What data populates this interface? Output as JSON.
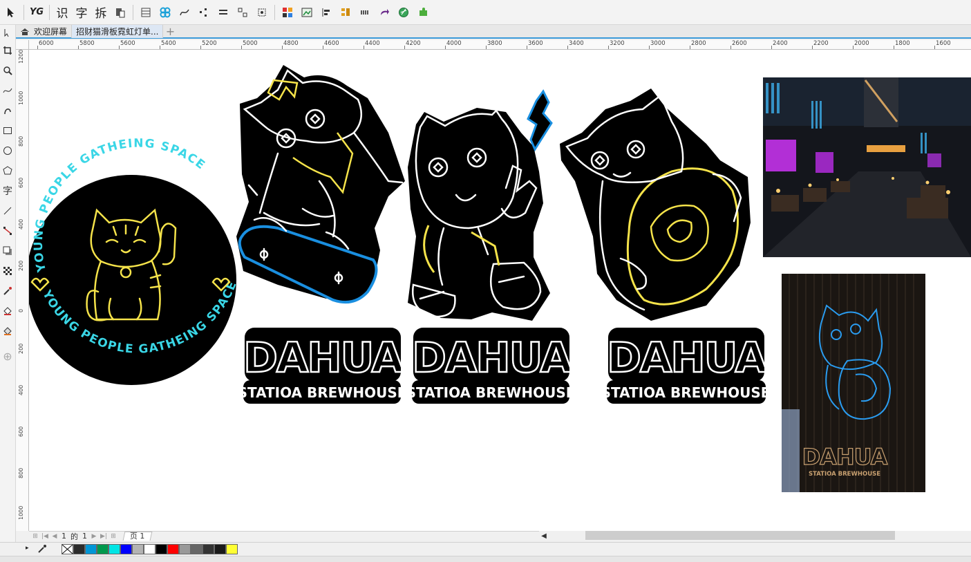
{
  "toolbar": {
    "items": [
      {
        "name": "pick-tool-button",
        "glyph": "➤"
      },
      {
        "name": "yg-plugin-button",
        "glyph": "YG"
      },
      {
        "name": "recognize-button",
        "glyph": "识"
      },
      {
        "name": "text-button",
        "glyph": "字"
      },
      {
        "name": "split-button",
        "glyph": "拆"
      }
    ]
  },
  "tabs": [
    {
      "label": "欢迎屏幕"
    },
    {
      "label": "招财猫滑板霓虹灯单..."
    }
  ],
  "ruler": {
    "top": [
      "6000",
      "5800",
      "5600",
      "5400",
      "5200",
      "5000",
      "4800",
      "4600",
      "4400",
      "4200",
      "4000",
      "3800",
      "3600",
      "3400",
      "3200",
      "3000",
      "2800",
      "2600",
      "2400",
      "2200",
      "2000",
      "1800",
      "1600"
    ],
    "left": [
      "1200",
      "1000",
      "800",
      "600",
      "400",
      "200",
      "0",
      "200",
      "400",
      "600",
      "800",
      "1000"
    ]
  },
  "badge": {
    "ring_text": "YOUNG PEOPLE GATHEING SPACE"
  },
  "logos": [
    {
      "title": "DAHUA",
      "subtitle": "STATIOA BREWHOUSE"
    },
    {
      "title": "DAHUA",
      "subtitle": "STATIOA BREWHOUSE"
    },
    {
      "title": "DAHUA",
      "subtitle": "STATIOA BREWHOUSE"
    }
  ],
  "photo_bottom": {
    "title": "DAHUA",
    "subtitle": "STATIOA BREWHOUSE"
  },
  "pagebar": {
    "current": "1",
    "of_label": "的",
    "total": "1",
    "page_tab": "页 1"
  },
  "palette": {
    "colors": [
      "#2b2b2b",
      "#0096d6",
      "#00994d",
      "#00e5e5",
      "#0000ff",
      "#b3b3b3",
      "#ffffff",
      "#000000",
      "#ff0000",
      "#999999",
      "#666666",
      "#333333",
      "#1a1a1a",
      "#ffff33"
    ]
  },
  "colors": {
    "accent": "#3b9ad9",
    "neon_yellow": "#f5e34a",
    "neon_blue": "#1a8fe0",
    "neon_cyan": "#3ad6e6"
  }
}
